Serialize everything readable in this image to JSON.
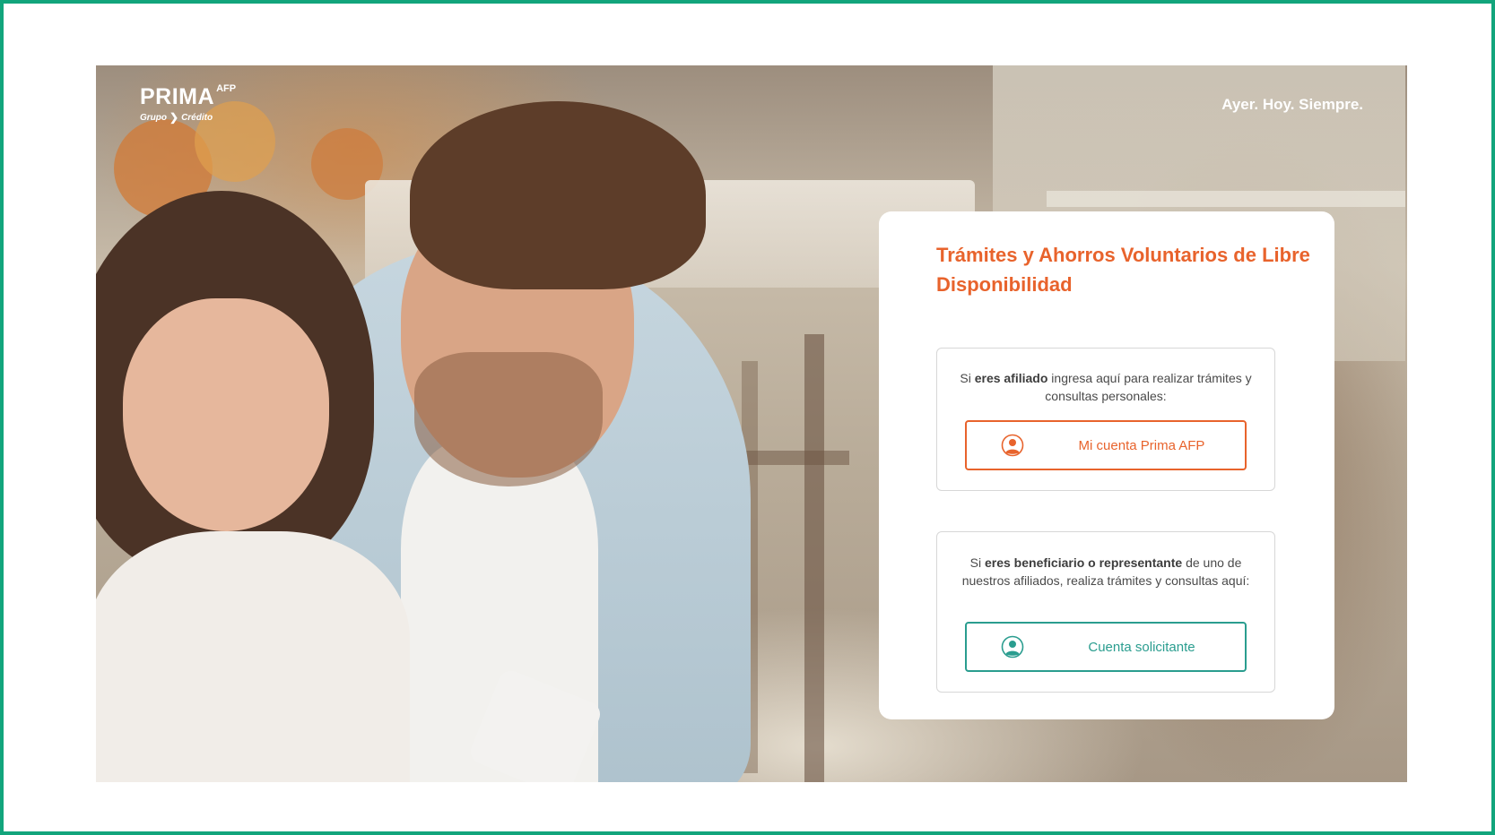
{
  "brand": {
    "logo_main": "PRIMA",
    "logo_sup": "AFP",
    "logo_sub_left": "Grupo",
    "logo_sub_right": "Crédito",
    "tagline": "Ayer. Hoy. Siempre."
  },
  "card": {
    "title": "Trámites y Ahorros Voluntarios de Libre Disponibilidad",
    "affiliate": {
      "text_prefix": "Si ",
      "text_bold": "eres afiliado",
      "text_suffix": " ingresa aquí para realizar trámites y consultas personales:",
      "button_label": "Mi cuenta Prima AFP",
      "button_icon": "user-icon"
    },
    "beneficiary": {
      "text_prefix": "Si ",
      "text_bold": "eres beneficiario o representante",
      "text_suffix": " de uno de nuestros afiliados, realiza trámites y consultas aquí:",
      "button_label": "Cuenta solicitante",
      "button_icon": "user-icon"
    }
  },
  "colors": {
    "frame_border": "#12a57c",
    "accent_orange": "#e8632c",
    "accent_teal": "#2a9d8f"
  }
}
